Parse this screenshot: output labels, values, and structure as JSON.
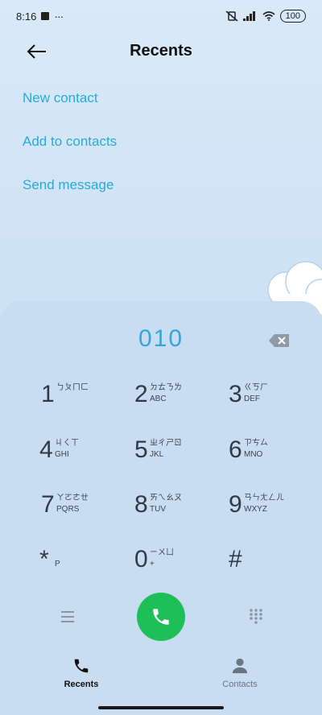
{
  "status_bar": {
    "time": "8:16",
    "battery": "100"
  },
  "header": {
    "title": "Recents"
  },
  "actions": [
    {
      "label": "New contact"
    },
    {
      "label": "Add to contacts"
    },
    {
      "label": "Send message"
    }
  ],
  "dialer": {
    "number": "010"
  },
  "keys": [
    {
      "digit": "1",
      "bopo": "ㄅㄆㄇㄈ",
      "letters": ""
    },
    {
      "digit": "2",
      "bopo": "ㄉㄊㄋㄌ",
      "letters": "ABC"
    },
    {
      "digit": "3",
      "bopo": "ㄍㄎㄏ",
      "letters": "DEF"
    },
    {
      "digit": "4",
      "bopo": "ㄐㄑㄒ",
      "letters": "GHI"
    },
    {
      "digit": "5",
      "bopo": "ㄓㄔㄕㄖ",
      "letters": "JKL"
    },
    {
      "digit": "6",
      "bopo": "ㄗㄘㄙ",
      "letters": "MNO"
    },
    {
      "digit": "7",
      "bopo": "ㄚㄛㄜㄝ",
      "letters": "PQRS"
    },
    {
      "digit": "8",
      "bopo": "ㄞㄟㄠㄡ",
      "letters": "TUV"
    },
    {
      "digit": "9",
      "bopo": "ㄢㄣㄤㄥㄦ",
      "letters": "WXYZ"
    },
    {
      "digit": "*",
      "bopo": "",
      "letters": "P"
    },
    {
      "digit": "0",
      "bopo": "ㄧㄨㄩ",
      "letters": "+"
    },
    {
      "digit": "#",
      "bopo": "",
      "letters": ""
    }
  ],
  "bottom_nav": {
    "recents": "Recents",
    "contacts": "Contacts"
  },
  "colors": {
    "accent": "#29a9d9",
    "call": "#1fbf57",
    "panel": "#c8dcf2"
  }
}
